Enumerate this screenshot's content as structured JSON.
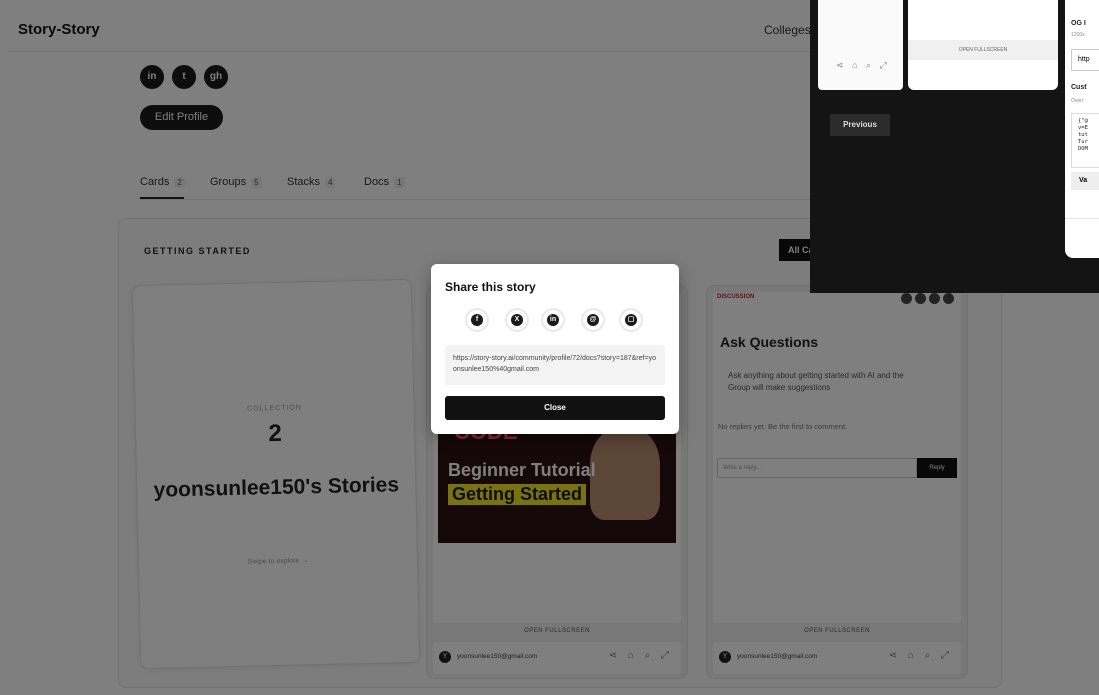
{
  "header": {
    "brand": "Story-Story",
    "nav_colleges": "Colleges"
  },
  "profile": {
    "social": [
      {
        "icon": "linkedin-icon",
        "glyph": "in"
      },
      {
        "icon": "twitter-icon",
        "glyph": "t"
      },
      {
        "icon": "github-icon",
        "glyph": "gh"
      }
    ],
    "edit_label": "Edit Profile"
  },
  "tabs": [
    {
      "label": "Cards",
      "count": "2"
    },
    {
      "label": "Groups",
      "count": "5"
    },
    {
      "label": "Stacks",
      "count": "4"
    },
    {
      "label": "Docs",
      "count": "1"
    }
  ],
  "section": {
    "title": "GETTING STARTED",
    "all_cards": "All Ca"
  },
  "collection": {
    "label": "COLLECTION",
    "number": "2",
    "title": "yoonsunlee150's Stories",
    "swipe": "Swipe to explore →"
  },
  "cards": {
    "open_fullscreen": "OPEN FULLSCREEN",
    "email": "yoonsunlee150@gmail.com",
    "avatar_initial": "Y"
  },
  "video": {
    "code": "CODE",
    "line1": "Beginner Tutorial",
    "line2": "Getting Started"
  },
  "discussion": {
    "label": "DISCUSSION",
    "title": "Ask Questions",
    "description": "Ask anything about getting started with AI and the Group will make suggestions",
    "empty": "No replies yet. Be the first to comment.",
    "reply_placeholder": "Write a reply...",
    "reply_button": "Reply"
  },
  "share": {
    "title": "Share this story",
    "icons": [
      {
        "name": "facebook-icon",
        "glyph": "f"
      },
      {
        "name": "x-icon",
        "glyph": "X"
      },
      {
        "name": "linkedin-icon",
        "glyph": "in"
      },
      {
        "name": "email-icon",
        "glyph": "@"
      },
      {
        "name": "copy-icon",
        "glyph": "▢"
      }
    ],
    "url": "https://story-story.ai/community/profile/72/docs?story=187&ref=yoonsunlee150%40gmail.com",
    "close": "Close"
  },
  "fullscreen": {
    "open_fullscreen": "OPEN FULLSCREEN",
    "previous": "Previous",
    "og_label": "OG I",
    "og_sub": "1200x",
    "og_value": "http",
    "custom_label": "Cust",
    "custom_sub": "Overr",
    "custom_code": "{\"@\nv=E\ntut\nTur\nDOM",
    "validate": "Va"
  },
  "colors": {
    "accent": "#111111",
    "discussion_red": "#b8282f",
    "video_yellow": "#f2e61a"
  }
}
